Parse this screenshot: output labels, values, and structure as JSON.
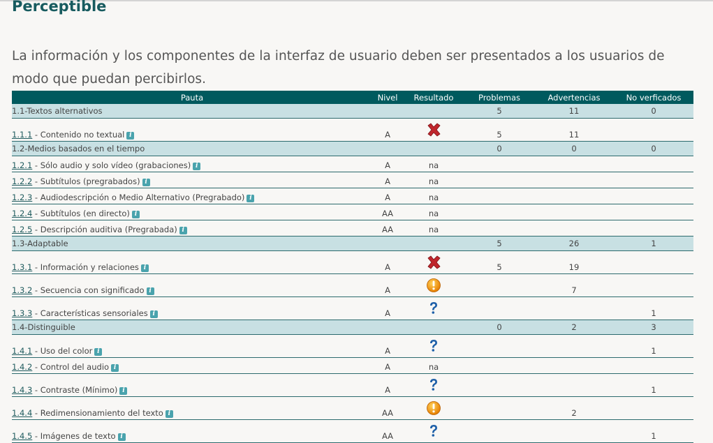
{
  "page": {
    "title": "Perceptible",
    "description": "La información y los componentes de la interfaz de usuario deben ser presentados a los usuarios de modo que puedan percibirlos."
  },
  "table": {
    "headers": [
      "Pauta",
      "Nivel",
      "Resultado",
      "Problemas",
      "Advertencias",
      "No verficados"
    ],
    "rows": [
      {
        "type": "group",
        "pauta": "1.1-Textos alternativos",
        "problemas": "5",
        "advertencias": "11",
        "no_verificados": "0"
      },
      {
        "type": "item",
        "code": "1.1.1",
        "label": " - Contenido no textual",
        "nivel": "A",
        "resultado": "fail",
        "problemas": "5",
        "advertencias": "11",
        "no_verificados": ""
      },
      {
        "type": "group",
        "pauta": "1.2-Medios basados en el tiempo",
        "problemas": "0",
        "advertencias": "0",
        "no_verificados": "0"
      },
      {
        "type": "item",
        "code": "1.2.1",
        "label": " - Sólo audio y solo vídeo (grabaciones)",
        "nivel": "A",
        "resultado": "na",
        "problemas": "",
        "advertencias": "",
        "no_verificados": ""
      },
      {
        "type": "item",
        "code": "1.2.2",
        "label": " - Subtítulos (pregrabados)",
        "nivel": "A",
        "resultado": "na",
        "problemas": "",
        "advertencias": "",
        "no_verificados": ""
      },
      {
        "type": "item",
        "code": "1.2.3",
        "label": " - Audiodescripción o Medio Alternativo (Pregrabado)",
        "nivel": "A",
        "resultado": "na",
        "problemas": "",
        "advertencias": "",
        "no_verificados": ""
      },
      {
        "type": "item",
        "code": "1.2.4",
        "label": " - Subtítulos (en directo)",
        "nivel": "AA",
        "resultado": "na",
        "problemas": "",
        "advertencias": "",
        "no_verificados": ""
      },
      {
        "type": "item",
        "code": "1.2.5",
        "label": " - Descripción auditiva (Pregrabada)",
        "nivel": "AA",
        "resultado": "na",
        "problemas": "",
        "advertencias": "",
        "no_verificados": ""
      },
      {
        "type": "group",
        "pauta": "1.3-Adaptable",
        "problemas": "5",
        "advertencias": "26",
        "no_verificados": "1"
      },
      {
        "type": "item",
        "code": "1.3.1",
        "label": " - Información y relaciones",
        "nivel": "A",
        "resultado": "fail",
        "problemas": "5",
        "advertencias": "19",
        "no_verificados": ""
      },
      {
        "type": "item",
        "code": "1.3.2",
        "label": " - Secuencia con significado",
        "nivel": "A",
        "resultado": "warning",
        "problemas": "",
        "advertencias": "7",
        "no_verificados": ""
      },
      {
        "type": "item",
        "code": "1.3.3",
        "label": " - Características sensoriales",
        "nivel": "A",
        "resultado": "unverified",
        "problemas": "",
        "advertencias": "",
        "no_verificados": "1"
      },
      {
        "type": "group",
        "pauta": "1.4-Distinguible",
        "problemas": "0",
        "advertencias": "2",
        "no_verificados": "3"
      },
      {
        "type": "item",
        "code": "1.4.1",
        "label": " - Uso del color",
        "nivel": "A",
        "resultado": "unverified",
        "problemas": "",
        "advertencias": "",
        "no_verificados": "1"
      },
      {
        "type": "item",
        "code": "1.4.2",
        "label": " - Control del audio",
        "nivel": "A",
        "resultado": "na",
        "problemas": "",
        "advertencias": "",
        "no_verificados": ""
      },
      {
        "type": "item",
        "code": "1.4.3",
        "label": " - Contraste (Mínimo)",
        "nivel": "A",
        "resultado": "unverified",
        "problemas": "",
        "advertencias": "",
        "no_verificados": "1"
      },
      {
        "type": "item",
        "code": "1.4.4",
        "label": " - Redimensionamiento del texto",
        "nivel": "AA",
        "resultado": "warning",
        "problemas": "",
        "advertencias": "2",
        "no_verificados": ""
      },
      {
        "type": "item",
        "code": "1.4.5",
        "label": " - Imágenes de texto",
        "nivel": "AA",
        "resultado": "unverified",
        "problemas": "",
        "advertencias": "",
        "no_verificados": "1"
      }
    ]
  },
  "icons": {
    "info": "info-icon",
    "info_glyph": "i",
    "fail": "red-x-icon",
    "warning": "orange-exclamation-icon",
    "unverified": "blue-question-icon",
    "na_text": "na"
  },
  "colors": {
    "header_bg": "#005a5e",
    "group_bg": "#c8e0e3",
    "title": "#175b5f",
    "fail": "#c0272d",
    "warning": "#f39c12",
    "unverified": "#1d5fa8"
  }
}
